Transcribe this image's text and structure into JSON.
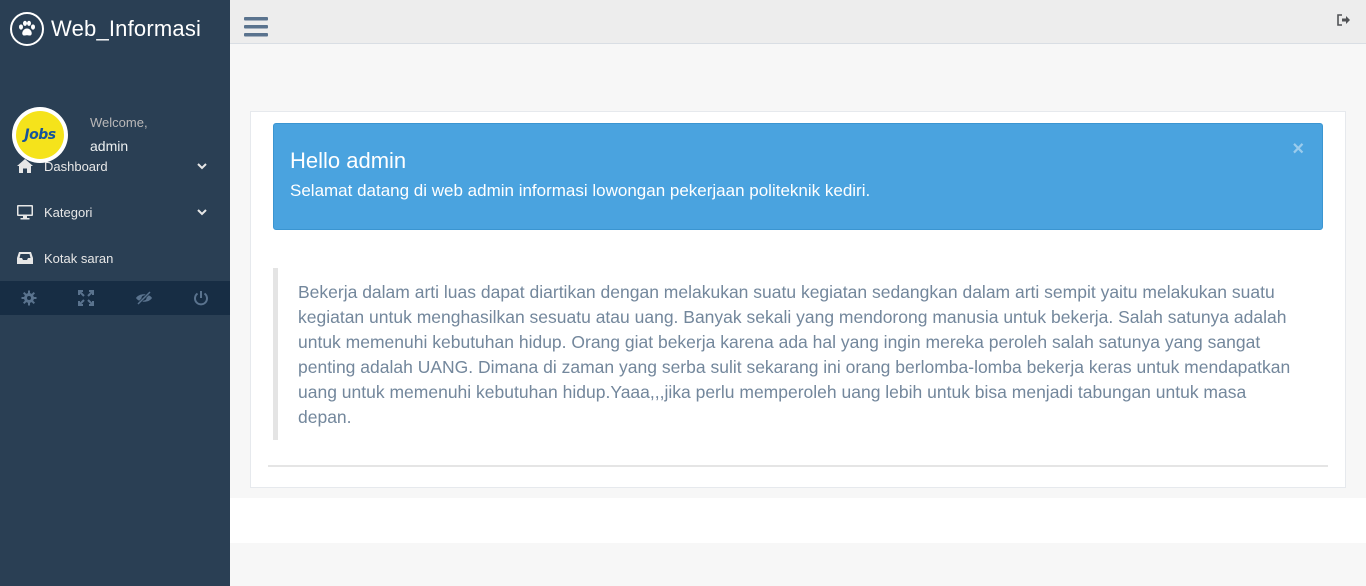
{
  "brand": {
    "title": "Web_Informasi",
    "icon": "paw-icon"
  },
  "profile": {
    "avatar_text": "Jobs",
    "welcome": "Welcome,",
    "username": "admin"
  },
  "sidebar": {
    "items": [
      {
        "label": "Dashboard",
        "icon": "home-icon",
        "has_chevron": true
      },
      {
        "label": "Kategori",
        "icon": "desktop-icon",
        "has_chevron": true
      },
      {
        "label": "Kotak saran",
        "icon": "inbox-icon",
        "has_chevron": false
      }
    ],
    "footer_buttons": [
      "settings-icon",
      "fullscreen-icon",
      "eye-slash-icon",
      "power-icon"
    ]
  },
  "alert": {
    "title": "Hello admin",
    "message": "Selamat datang di web admin informasi lowongan pekerjaan politeknik kediri.",
    "close": "×"
  },
  "quote": {
    "text": "Bekerja dalam arti luas dapat diartikan dengan melakukan suatu kegiatan sedangkan dalam arti sempit yaitu melakukan suatu kegiatan untuk menghasilkan sesuatu atau uang. Banyak sekali yang mendorong manusia untuk bekerja. Salah satunya adalah untuk memenuhi kebutuhan hidup. Orang giat bekerja karena ada hal yang ingin mereka peroleh salah satunya yang sangat penting adalah UANG. Dimana di zaman yang serba sulit sekarang ini orang berlomba-lomba bekerja keras untuk mendapatkan uang untuk memenuhi kebutuhan hidup.Yaaa,,,jika perlu memperoleh uang lebih untuk bisa menjadi tabungan untuk masa depan."
  },
  "colors": {
    "sidebar": "#2a3f54",
    "sidebar_footer": "#172d44",
    "alert": "#4aa3df",
    "body_text": "#73879c"
  }
}
